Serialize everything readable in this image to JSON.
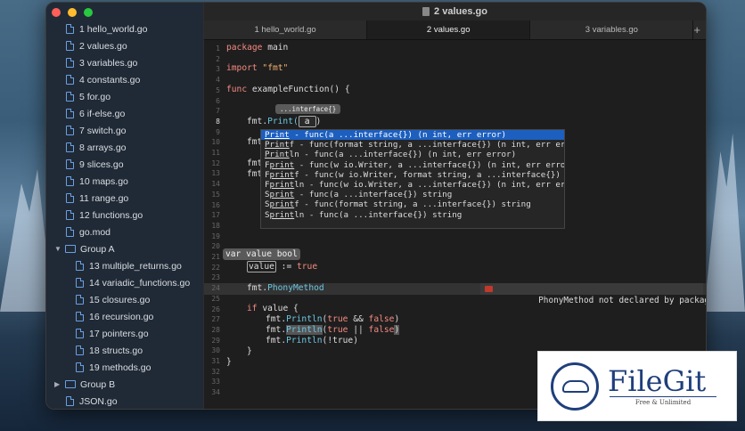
{
  "window": {
    "title": "2 values.go"
  },
  "traffic_lights": {
    "close": "#fe5f57",
    "minimize": "#febc2e",
    "zoom": "#28c840"
  },
  "sidebar": {
    "files": [
      {
        "label": "1 hello_world.go",
        "kind": "file"
      },
      {
        "label": "2 values.go",
        "kind": "file"
      },
      {
        "label": "3 variables.go",
        "kind": "file"
      },
      {
        "label": "4 constants.go",
        "kind": "file"
      },
      {
        "label": "5 for.go",
        "kind": "file"
      },
      {
        "label": "6 if-else.go",
        "kind": "file"
      },
      {
        "label": "7 switch.go",
        "kind": "file"
      },
      {
        "label": "8 arrays.go",
        "kind": "file"
      },
      {
        "label": "9 slices.go",
        "kind": "file"
      },
      {
        "label": "10 maps.go",
        "kind": "file"
      },
      {
        "label": "11 range.go",
        "kind": "file"
      },
      {
        "label": "12 functions.go",
        "kind": "file"
      },
      {
        "label": "go.mod",
        "kind": "file"
      },
      {
        "label": "Group A",
        "kind": "folder-open"
      },
      {
        "label": "13 multiple_returns.go",
        "kind": "child"
      },
      {
        "label": "14 variadic_functions.go",
        "kind": "child"
      },
      {
        "label": "15 closures.go",
        "kind": "child"
      },
      {
        "label": "16 recursion.go",
        "kind": "child"
      },
      {
        "label": "17 pointers.go",
        "kind": "child"
      },
      {
        "label": "18 structs.go",
        "kind": "child"
      },
      {
        "label": "19 methods.go",
        "kind": "child"
      },
      {
        "label": "Group B",
        "kind": "folder-closed"
      },
      {
        "label": "JSON.go",
        "kind": "file"
      }
    ]
  },
  "tabs": [
    {
      "label": "1 hello_world.go"
    },
    {
      "label": "2 values.go"
    },
    {
      "label": "3 variables.go"
    }
  ],
  "tab_add_icon": "+",
  "code": {
    "line_numbers": [
      "1",
      "2",
      "3",
      "4",
      "5",
      "6",
      "7",
      "8",
      "9",
      "10",
      "11",
      "12",
      "13",
      "14",
      "15",
      "16",
      "17",
      "18",
      "19",
      "20",
      "21",
      "22",
      "23",
      "24",
      "25",
      "26",
      "27",
      "28",
      "29",
      "30",
      "31",
      "32",
      "33",
      "34"
    ],
    "l1_kw": "package",
    "l1_rest": " main",
    "l3_kw": "import",
    "l3_str": " \"fmt\"",
    "l5_kw": "func",
    "l5_rest": " exampleFunction() {",
    "l8_pre": "fmt.",
    "l8_fn": "Print(",
    "l8_arg": "a",
    "l8_close": ")",
    "l10_pre": "fmt",
    "l12_pre": "fmt",
    "l13_pre": "fmt",
    "l22_val": "value",
    "l22_rest": " := ",
    "l22_true": "true",
    "l24_pre": "fmt.",
    "l24_fn": "PhonyMethod",
    "l26_kw": "if",
    "l26_rest": " value {",
    "l27_pre": "fmt.",
    "l27_fn": "Println",
    "l27_a": "(",
    "l27_t": "true",
    "l27_op": " && ",
    "l27_f": "false",
    "l27_b": ")",
    "l28_pre": "fmt.",
    "l28_fn": "Println",
    "l28_a": "(",
    "l28_t": "true",
    "l28_op": " || ",
    "l28_f": "false",
    "l28_b": ")",
    "l29_pre": "fmt.",
    "l29_fn": "Println",
    "l29_rest": "(!true)",
    "l30": "}",
    "l31": "}"
  },
  "param_hint": "...interface{}",
  "type_hint": "var value bool",
  "autocomplete": [
    {
      "label": "Print - func(a ...interface{}) (n int, err error)",
      "match": "Print",
      "rest": " - func(a ...interface{}) (n int, err error)"
    },
    {
      "label": "Printf - func(format string, a ...interface{}) (n int, err error)",
      "match": "Print",
      "rest": "f - func(format string, a ...interface{}) (n int, err error)"
    },
    {
      "label": "Println - func(a ...interface{}) (n int, err error)",
      "match": "Print",
      "rest": "ln - func(a ...interface{}) (n int, err error)"
    },
    {
      "label": "Fprint - func(w io.Writer, a ...interface{}) (n int, err error)",
      "pre": "F",
      "match": "print",
      "rest": " - func(w io.Writer, a ...interface{}) (n int, err error)"
    },
    {
      "label": "Fprintf - func(w io.Writer, format string, a ...interface{}) (n int, err error)",
      "pre": "F",
      "match": "print",
      "rest": "f - func(w io.Writer, format string, a ...interface{}) (n int, err error)"
    },
    {
      "label": "Fprintln - func(w io.Writer, a ...interface{}) (n int, err error)",
      "pre": "F",
      "match": "print",
      "rest": "ln - func(w io.Writer, a ...interface{}) (n int, err error)"
    },
    {
      "label": "Sprint - func(a ...interface{}) string",
      "pre": "S",
      "match": "print",
      "rest": " - func(a ...interface{}) string"
    },
    {
      "label": "Sprintf - func(format string, a ...interface{}) string",
      "pre": "S",
      "match": "print",
      "rest": "f - func(format string, a ...interface{}) string"
    },
    {
      "label": "Sprintln - func(a ...interface{}) string",
      "pre": "S",
      "match": "print",
      "rest": "ln - func(a ...interface{}) string"
    }
  ],
  "diagnostic": {
    "message": "PhonyMethod not declared by package fmt",
    "color": "#c0392b"
  },
  "watermark": {
    "name": "FileGit",
    "tagline": "Free & Unlimited"
  }
}
